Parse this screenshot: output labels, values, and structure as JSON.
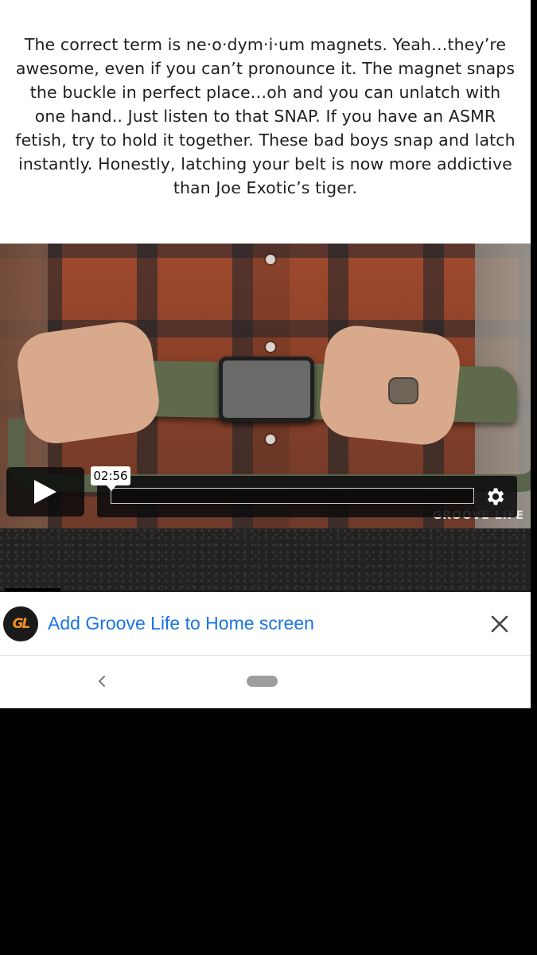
{
  "article": {
    "paragraph": "The correct term is ne·o·dym·i·um magnets. Yeah…they’re awesome, even if you can’t pronounce it. The magnet snaps the buckle in perfect place…oh and you can unlatch with one hand.. Just listen to that SNAP. If you have an ASMR fetish, try to hold it together. These bad boys snap and latch instantly. Honestly, latching your belt is now more addictive than Joe Exotic’s tiger."
  },
  "video": {
    "time_tooltip": "02:56",
    "watermark": "GROOVE LIFE",
    "icons": {
      "play": "play-icon",
      "settings": "gear-icon"
    }
  },
  "install_banner": {
    "logo_text": "GL",
    "label": "Add Groove Life to Home screen",
    "close_icon": "close-icon"
  },
  "system_nav": {
    "back_icon": "chevron-left-icon",
    "home_icon": "home-pill-icon"
  },
  "colors": {
    "link_blue": "#1a73e8",
    "brand_orange": "#f29221",
    "text": "#1f1f1f"
  }
}
